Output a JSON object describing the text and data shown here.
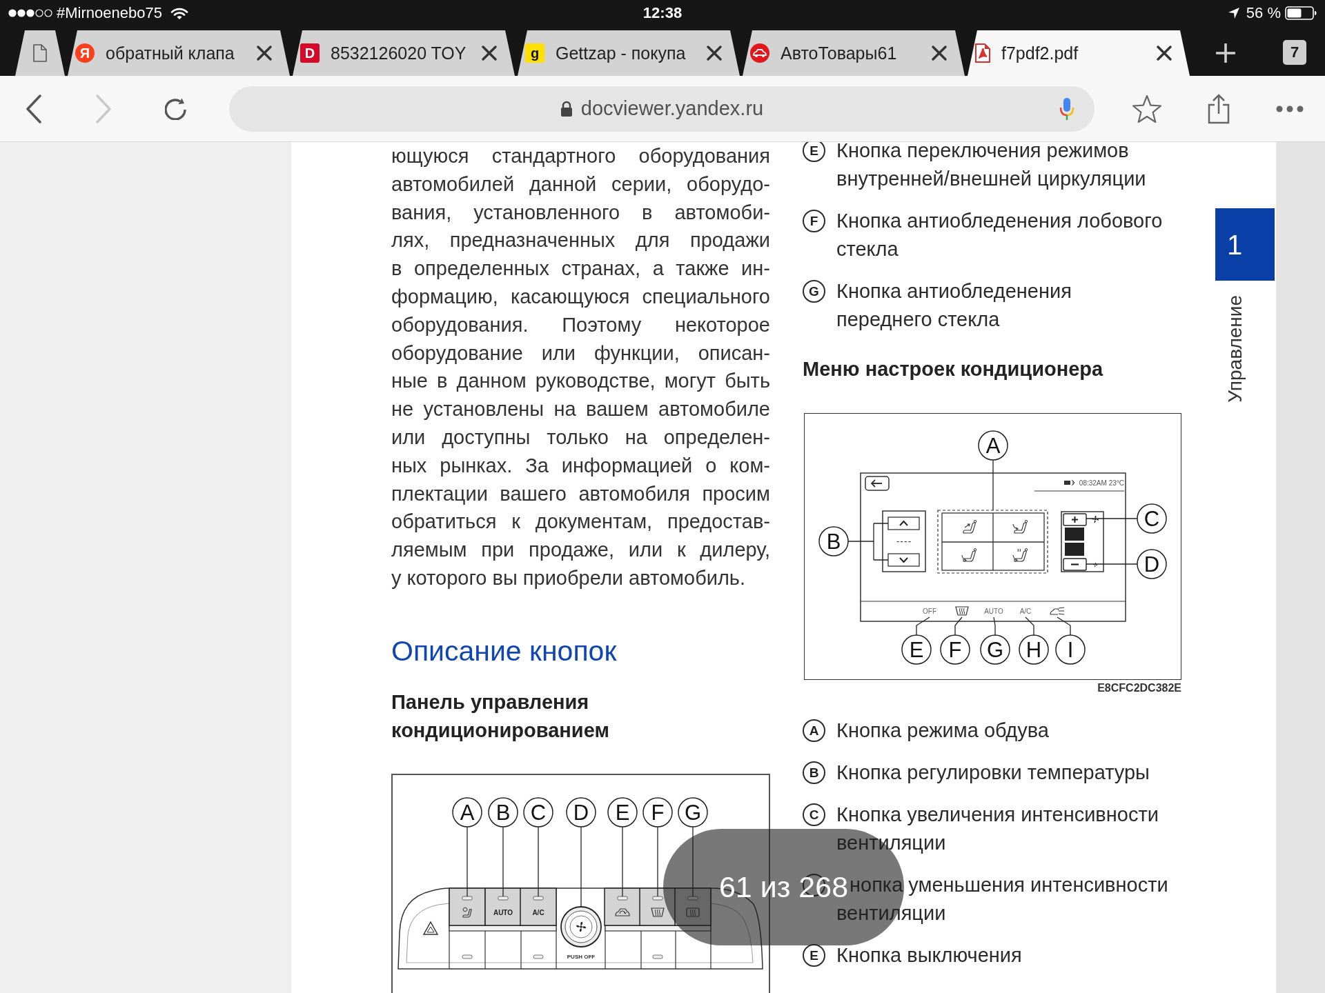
{
  "status_bar": {
    "carrier": "#Mirnoenebo75",
    "time": "12:38",
    "battery": "56 %"
  },
  "tabs": [
    {
      "selected": false,
      "icon": {
        "kind": "page"
      }
    },
    {
      "title": "обратный клапа",
      "selected": false,
      "icon": {
        "kind": "disc",
        "text": "Я",
        "color": "#fc3f1d"
      }
    },
    {
      "title": "8532126020 TOY",
      "selected": false,
      "icon": {
        "kind": "tile",
        "text": "D",
        "color": "#d7092b"
      }
    },
    {
      "title": "Gettzap - покупа",
      "selected": false,
      "icon": {
        "kind": "tile",
        "text": "g",
        "color": "#ffe000"
      }
    },
    {
      "title": "АвтоТовары61",
      "selected": false,
      "icon": {
        "kind": "car",
        "color": "#e3171b"
      }
    },
    {
      "title": "f7pdf2.pdf",
      "selected": true,
      "icon": {
        "kind": "pdf",
        "color": "#d8302f"
      }
    }
  ],
  "tab_count": "7",
  "toolbar": {
    "buttons": [
      {
        "kind": "back",
        "disabled": false
      },
      {
        "kind": "forward",
        "disabled": true
      },
      {
        "kind": "reload",
        "disabled": false
      }
    ],
    "url": "docviewer.yandex.ru"
  },
  "document": {
    "paragraph_lines": [
      "ющуюся стандартного оборудования",
      "автомобилей данной серии, оборудо-",
      "вания, установленного в автомоби-",
      "лях, предназначенных для продажи",
      "в определенных странах, а также ин-",
      "формацию, касающуюся специального",
      "оборудования. Поэтому некоторое",
      "оборудование или функции, описан-",
      "ные в данном руководстве, могут быть",
      "не установлены на вашем автомобиле",
      "или доступны только на определен-",
      "ных рынках. За информацией о ком-",
      "плектации вашего автомобиля просим",
      "обратиться к документам, предостав-",
      "ляемым при продаже, или к дилеру,",
      "у которого вы приобрели автомобиль."
    ],
    "heading": "Описание кнопок",
    "subheading": "Панель управления кондиционированием",
    "panel_figure": {
      "buttons": [
        {
          "callout": "A",
          "kind": "icon"
        },
        {
          "callout": "B",
          "kind": "label",
          "label": "AUTO"
        },
        {
          "callout": "C",
          "kind": "label",
          "label": "A/C"
        },
        {
          "callout": "D",
          "kind": "knob",
          "label": "PUSH OFF"
        },
        {
          "callout": "E",
          "kind": "icon"
        },
        {
          "callout": "F",
          "kind": "icon"
        },
        {
          "callout": "G",
          "kind": "icon"
        }
      ]
    },
    "upper_legend": [
      {
        "letter": "E",
        "text": "Кнопка переключения режимов\nвнутренней/внешней циркуляции"
      },
      {
        "letter": "F",
        "text": "Кнопка антиобледенения лобового\nстекла"
      },
      {
        "letter": "G",
        "text": "Кнопка антиобледенения\nпереднего стекла"
      }
    ],
    "menu_heading": "Меню настроек кондиционера",
    "menu_figure": {
      "status": "08:32AM 23°C",
      "temperature": "----",
      "callouts": [
        "A",
        "B",
        "C",
        "D"
      ],
      "bottom_bar": [
        {
          "callout": "E",
          "kind": "label",
          "label": "OFF"
        },
        {
          "callout": "F",
          "kind": "icon"
        },
        {
          "callout": "G",
          "kind": "label",
          "label": "AUTO"
        },
        {
          "callout": "H",
          "kind": "label",
          "label": "A/C"
        },
        {
          "callout": "I",
          "kind": "icon"
        }
      ],
      "code": "E8CFC2DC382E"
    },
    "lower_legend": [
      {
        "kind": "marker",
        "letter": "A",
        "text": "Кнопка режима обдува"
      },
      {
        "kind": "marker",
        "letter": "B",
        "text": "Кнопка регулировки температуры"
      },
      {
        "kind": "marker",
        "letter": "C",
        "text": "Кнопка увеличения интенсивности\nвентиляции"
      },
      {
        "kind": "covered",
        "text": "нопка уменьшения интенсивности\nвентиляции"
      },
      {
        "kind": "marker",
        "letter": "E",
        "text": "Кнопка выключения"
      }
    ],
    "side_tab": {
      "number": "1",
      "label": "Управление"
    }
  },
  "page_indicator": "61 из 268"
}
